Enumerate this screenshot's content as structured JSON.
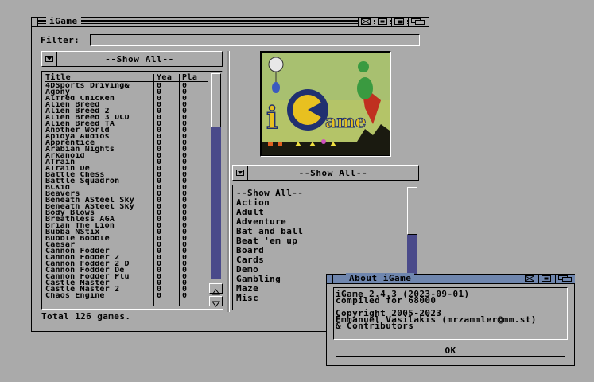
{
  "main_window": {
    "title": "iGame",
    "filter_label": "Filter:",
    "filter_value": "",
    "show_all_left": "--Show All--",
    "columns": [
      "Title",
      "Yea",
      "Pla"
    ],
    "games": [
      {
        "title": "4DSports Driving&",
        "year": "0",
        "players": "0"
      },
      {
        "title": "Agony",
        "year": "0",
        "players": "0"
      },
      {
        "title": "Alfred Chicken",
        "year": "0",
        "players": "0"
      },
      {
        "title": "Alien Breed",
        "year": "0",
        "players": "0"
      },
      {
        "title": "Alien Breed 2",
        "year": "0",
        "players": "0"
      },
      {
        "title": "Alien Breed 3 DCD",
        "year": "0",
        "players": "0"
      },
      {
        "title": "Alien Breed TA",
        "year": "0",
        "players": "0"
      },
      {
        "title": "Another World",
        "year": "0",
        "players": "0"
      },
      {
        "title": "Apidya Audios",
        "year": "0",
        "players": "0"
      },
      {
        "title": "Apprentice",
        "year": "0",
        "players": "0"
      },
      {
        "title": "Arabian Nights",
        "year": "0",
        "players": "0"
      },
      {
        "title": "Arkanoid",
        "year": "0",
        "players": "0"
      },
      {
        "title": "ATrain",
        "year": "0",
        "players": "0"
      },
      {
        "title": "ATrain De",
        "year": "0",
        "players": "0"
      },
      {
        "title": "Battle Chess",
        "year": "0",
        "players": "0"
      },
      {
        "title": "Battle Squadron",
        "year": "0",
        "players": "0"
      },
      {
        "title": "BCKid",
        "year": "0",
        "players": "0"
      },
      {
        "title": "Beavers",
        "year": "0",
        "players": "0"
      },
      {
        "title": "Beneath ASteel Sky",
        "year": "0",
        "players": "0"
      },
      {
        "title": "Beneath ASteel Sky",
        "year": "0",
        "players": "0"
      },
      {
        "title": "Body Blows",
        "year": "0",
        "players": "0"
      },
      {
        "title": "Breathless AGA",
        "year": "0",
        "players": "0"
      },
      {
        "title": "Brian The Lion",
        "year": "0",
        "players": "0"
      },
      {
        "title": "Bubba NStix",
        "year": "0",
        "players": "0"
      },
      {
        "title": "Bubble Bobble",
        "year": "0",
        "players": "0"
      },
      {
        "title": "Caesar",
        "year": "0",
        "players": "0"
      },
      {
        "title": "Cannon Fodder",
        "year": "0",
        "players": "0"
      },
      {
        "title": "Cannon Fodder 2",
        "year": "0",
        "players": "0"
      },
      {
        "title": "Cannon Fodder 2 D",
        "year": "0",
        "players": "0"
      },
      {
        "title": "Cannon Fodder De",
        "year": "0",
        "players": "0"
      },
      {
        "title": "Cannon Fodder Plu",
        "year": "0",
        "players": "0"
      },
      {
        "title": "Castle Master",
        "year": "0",
        "players": "0"
      },
      {
        "title": "Castle Master 2",
        "year": "0",
        "players": "0"
      },
      {
        "title": "Chaos Engine",
        "year": "0",
        "players": "0"
      }
    ],
    "status": "Total 126 games.",
    "show_all_right": "--Show All--",
    "genres": [
      "--Show All--",
      "Action",
      "Adult",
      "Adventure",
      "Bat and ball",
      "Beat 'em up",
      "Board",
      "Cards",
      "Demo",
      "Gambling",
      "Maze",
      "Misc"
    ],
    "logo_text": "iGame"
  },
  "about_window": {
    "title": "About iGame",
    "lines": [
      "iGame 2.4.3 (2023-09-01)",
      "compiled for 68000",
      "",
      "Copyright 2005-2023",
      "Emmanuel Vasilakis (mrzammler@mm.st)",
      "& Contributors"
    ],
    "ok_label": "OK"
  },
  "colors": {
    "background": "#aaaaaa",
    "active_title": "#6f86ae",
    "scroll_track": "#4a4a8a"
  }
}
